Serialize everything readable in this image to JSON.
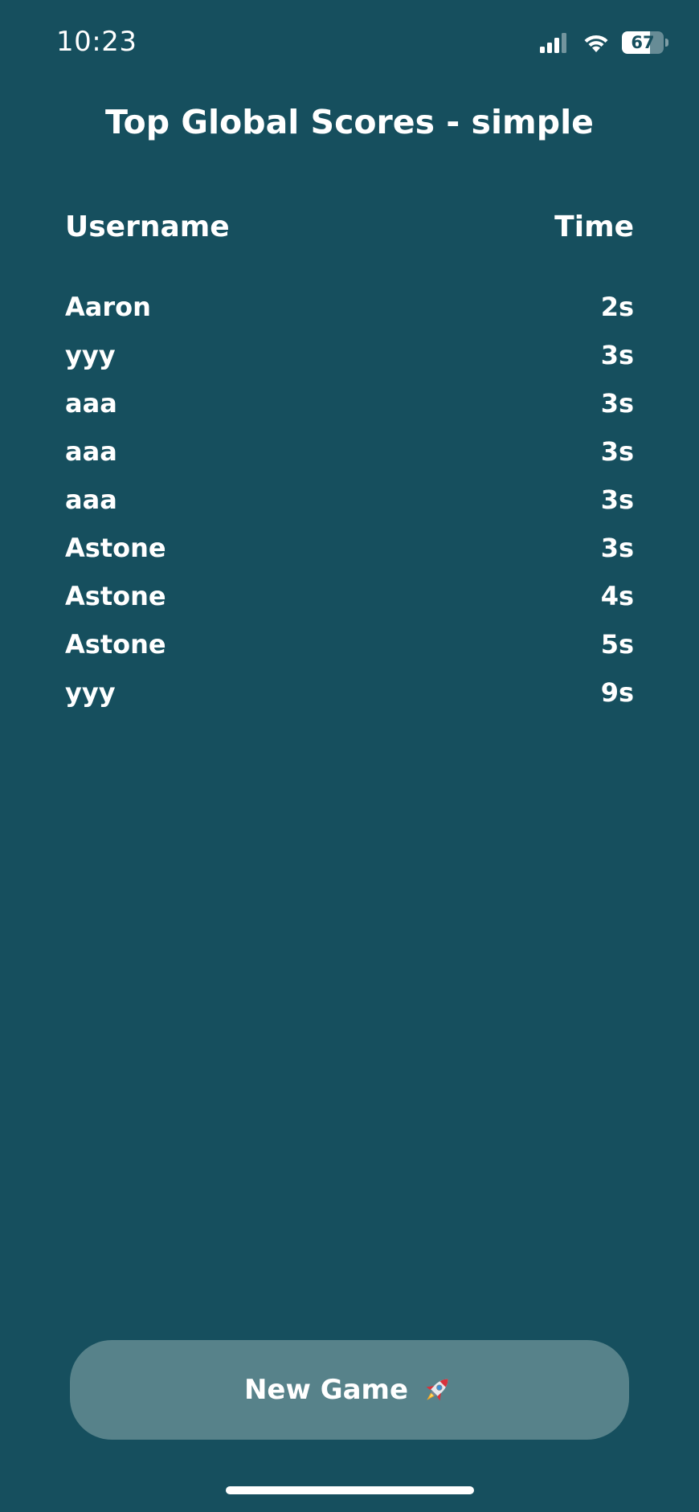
{
  "status_bar": {
    "time": "10:23",
    "battery_level": "67",
    "battery_fraction": 0.67
  },
  "page": {
    "title": "Top Global Scores - simple"
  },
  "table": {
    "headers": {
      "username": "Username",
      "time": "Time"
    },
    "rows": [
      {
        "username": "Aaron",
        "time": "2s"
      },
      {
        "username": "yyy",
        "time": "3s"
      },
      {
        "username": "aaa",
        "time": "3s"
      },
      {
        "username": "aaa",
        "time": "3s"
      },
      {
        "username": "aaa",
        "time": "3s"
      },
      {
        "username": "Astone",
        "time": "3s"
      },
      {
        "username": "Astone",
        "time": "4s"
      },
      {
        "username": "Astone",
        "time": "5s"
      },
      {
        "username": "yyy",
        "time": "9s"
      }
    ]
  },
  "actions": {
    "new_game_label": "New Game",
    "new_game_icon": "rocket-icon"
  },
  "colors": {
    "background": "#164F5E",
    "button": "#57828A",
    "text": "#FFFFFF"
  }
}
